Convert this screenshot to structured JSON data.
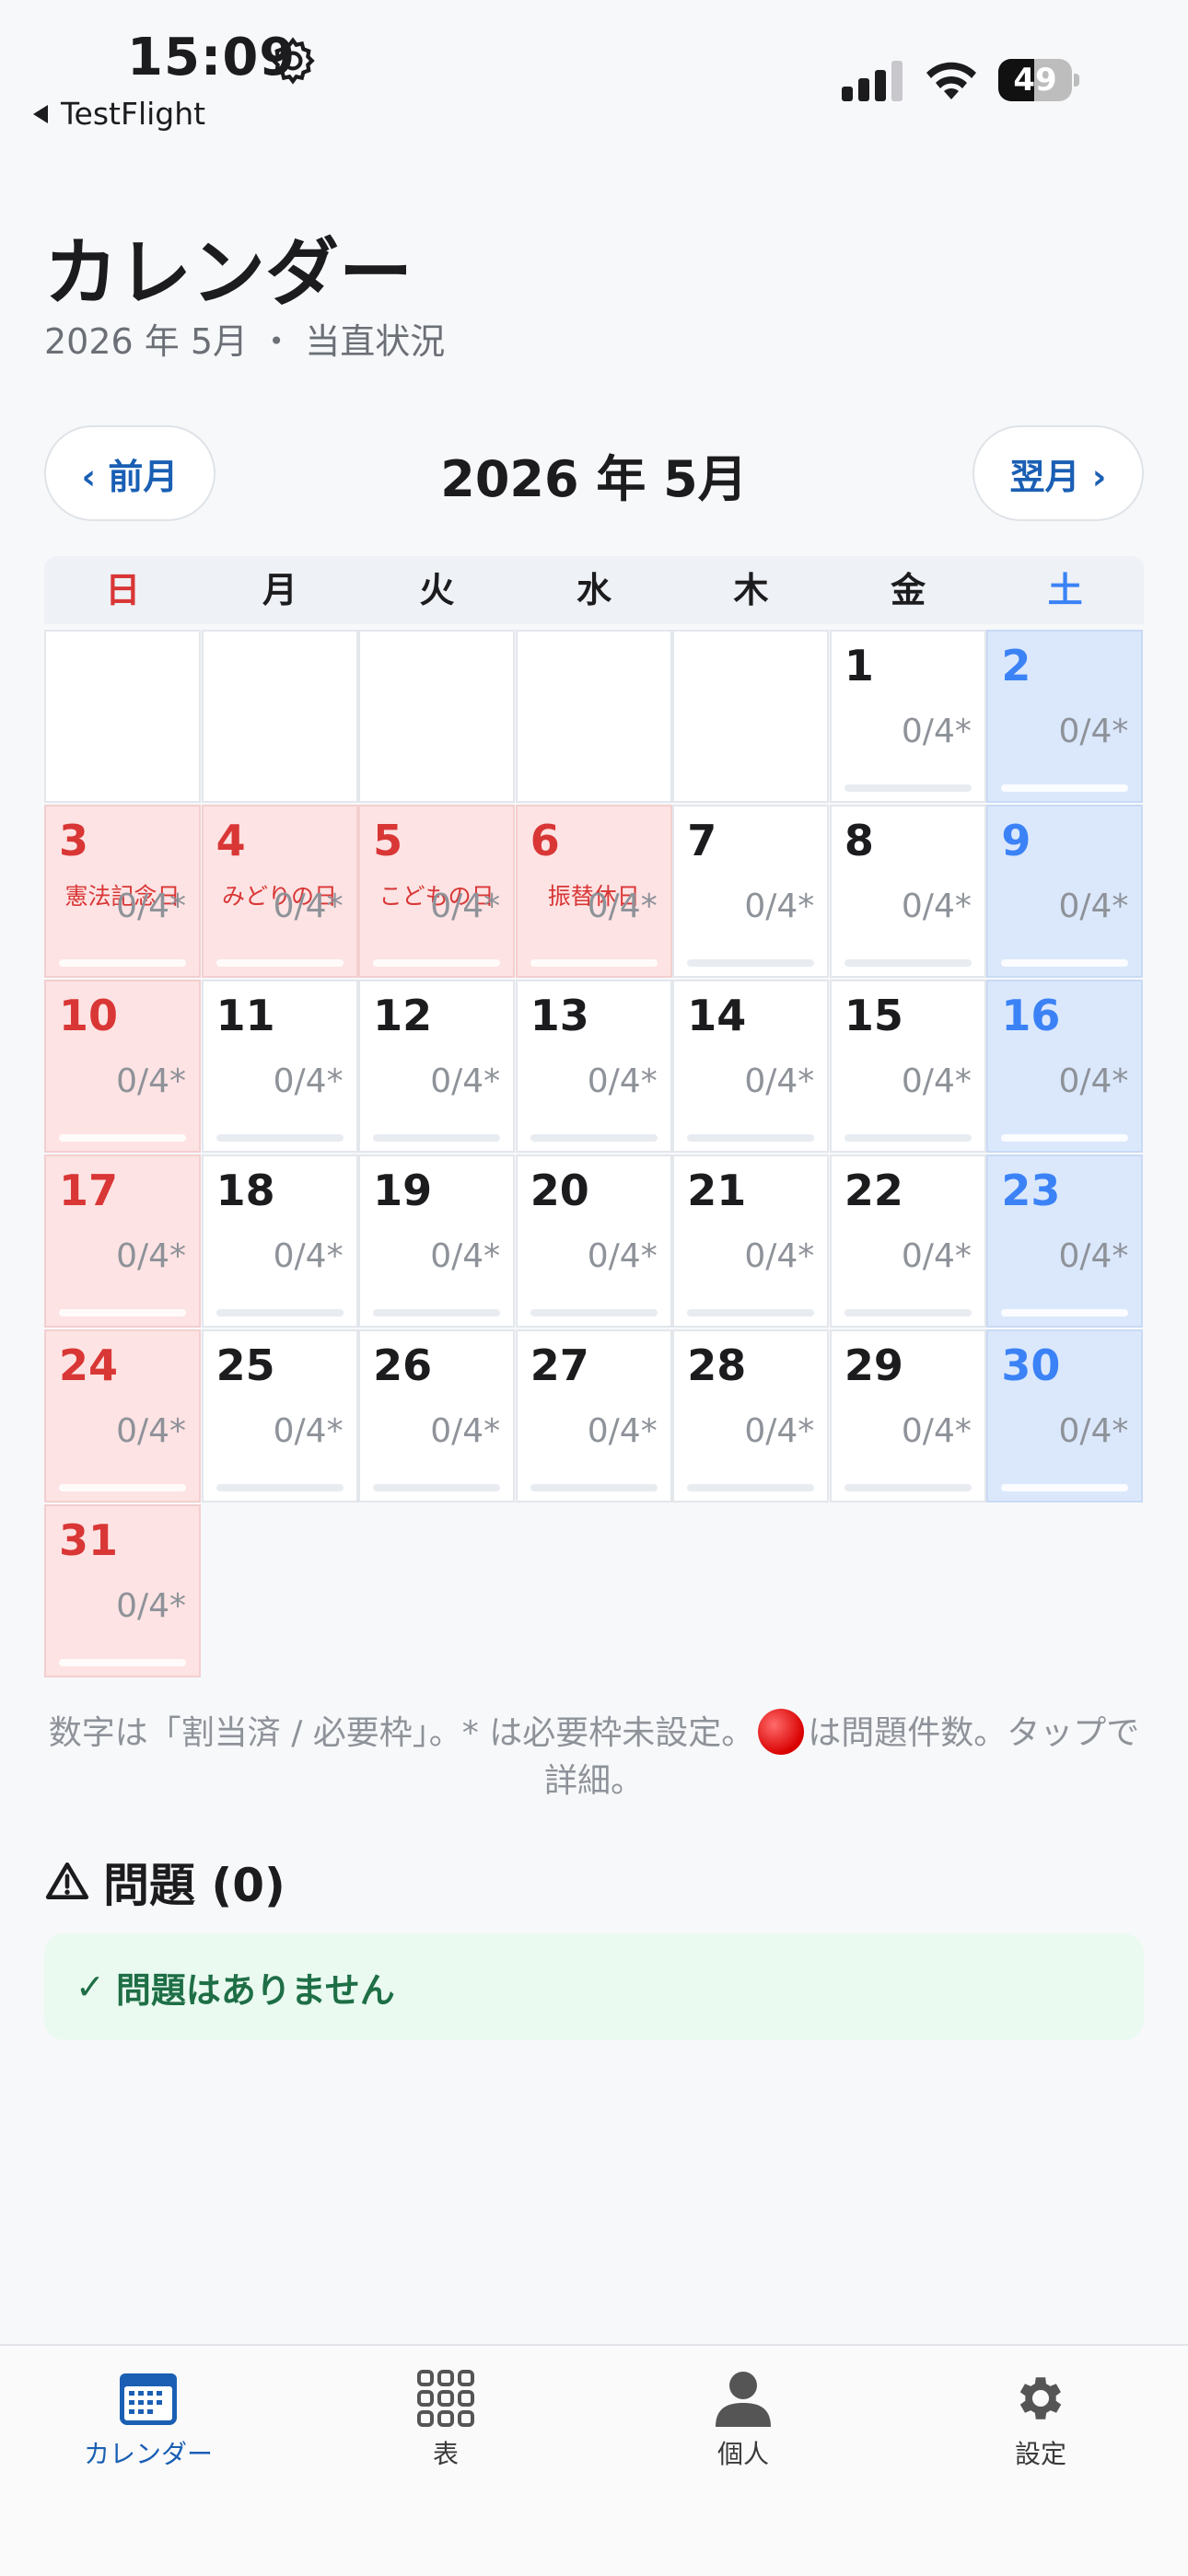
{
  "status_bar": {
    "time": "15:09",
    "back_app": "TestFlight",
    "battery": "49",
    "battery_level": 0.49
  },
  "header": {
    "title": "カレンダー",
    "subtitle": "2026 年 5月 ・ 当直状況"
  },
  "month_nav": {
    "prev_label": "‹ 前月",
    "next_label": "翌月 ›",
    "current": "2026 年 5月"
  },
  "weekdays": [
    "日",
    "月",
    "火",
    "水",
    "木",
    "金",
    "土"
  ],
  "calendar": {
    "leading_empty": 5,
    "days": [
      {
        "day": "1",
        "count": "0/4*",
        "type": "normal",
        "holiday": ""
      },
      {
        "day": "2",
        "count": "0/4*",
        "type": "sat",
        "holiday": ""
      },
      {
        "day": "3",
        "count": "0/4*",
        "type": "sun",
        "holiday": "憲法記念日"
      },
      {
        "day": "4",
        "count": "0/4*",
        "type": "holiday",
        "holiday": "みどりの日"
      },
      {
        "day": "5",
        "count": "0/4*",
        "type": "holiday",
        "holiday": "こどもの日"
      },
      {
        "day": "6",
        "count": "0/4*",
        "type": "holiday",
        "holiday": "振替休日"
      },
      {
        "day": "7",
        "count": "0/4*",
        "type": "normal",
        "holiday": ""
      },
      {
        "day": "8",
        "count": "0/4*",
        "type": "normal",
        "holiday": ""
      },
      {
        "day": "9",
        "count": "0/4*",
        "type": "sat",
        "holiday": ""
      },
      {
        "day": "10",
        "count": "0/4*",
        "type": "sun",
        "holiday": ""
      },
      {
        "day": "11",
        "count": "0/4*",
        "type": "normal",
        "holiday": ""
      },
      {
        "day": "12",
        "count": "0/4*",
        "type": "normal",
        "holiday": ""
      },
      {
        "day": "13",
        "count": "0/4*",
        "type": "normal",
        "holiday": ""
      },
      {
        "day": "14",
        "count": "0/4*",
        "type": "normal",
        "holiday": ""
      },
      {
        "day": "15",
        "count": "0/4*",
        "type": "normal",
        "holiday": ""
      },
      {
        "day": "16",
        "count": "0/4*",
        "type": "sat",
        "holiday": ""
      },
      {
        "day": "17",
        "count": "0/4*",
        "type": "sun",
        "holiday": ""
      },
      {
        "day": "18",
        "count": "0/4*",
        "type": "normal",
        "holiday": ""
      },
      {
        "day": "19",
        "count": "0/4*",
        "type": "normal",
        "holiday": ""
      },
      {
        "day": "20",
        "count": "0/4*",
        "type": "normal",
        "holiday": ""
      },
      {
        "day": "21",
        "count": "0/4*",
        "type": "normal",
        "holiday": ""
      },
      {
        "day": "22",
        "count": "0/4*",
        "type": "normal",
        "holiday": ""
      },
      {
        "day": "23",
        "count": "0/4*",
        "type": "sat",
        "holiday": ""
      },
      {
        "day": "24",
        "count": "0/4*",
        "type": "sun",
        "holiday": ""
      },
      {
        "day": "25",
        "count": "0/4*",
        "type": "normal",
        "holiday": ""
      },
      {
        "day": "26",
        "count": "0/4*",
        "type": "normal",
        "holiday": ""
      },
      {
        "day": "27",
        "count": "0/4*",
        "type": "normal",
        "holiday": ""
      },
      {
        "day": "28",
        "count": "0/4*",
        "type": "normal",
        "holiday": ""
      },
      {
        "day": "29",
        "count": "0/4*",
        "type": "normal",
        "holiday": ""
      },
      {
        "day": "30",
        "count": "0/4*",
        "type": "sat",
        "holiday": ""
      },
      {
        "day": "31",
        "count": "0/4*",
        "type": "sun",
        "holiday": ""
      }
    ]
  },
  "legend": {
    "part1": "数字は「割当済 / 必要枠」。* は必要枠未設定。",
    "part2": "は問題件数。タップで詳細。"
  },
  "issues": {
    "title": "問題 (0)",
    "ok_check": "✓",
    "ok_message": "問題はありません"
  },
  "tabs": [
    {
      "label": "カレンダー",
      "icon": "calendar-icon",
      "active": true
    },
    {
      "label": "表",
      "icon": "grid-icon",
      "active": false
    },
    {
      "label": "個人",
      "icon": "person-icon",
      "active": false
    },
    {
      "label": "設定",
      "icon": "gear-icon",
      "active": false
    }
  ],
  "colors": {
    "accent": "#1a5fb4",
    "sunday_bg": "#fde3e3",
    "saturday_bg": "#dbe8fc",
    "ok_bg": "#eafaf0"
  }
}
